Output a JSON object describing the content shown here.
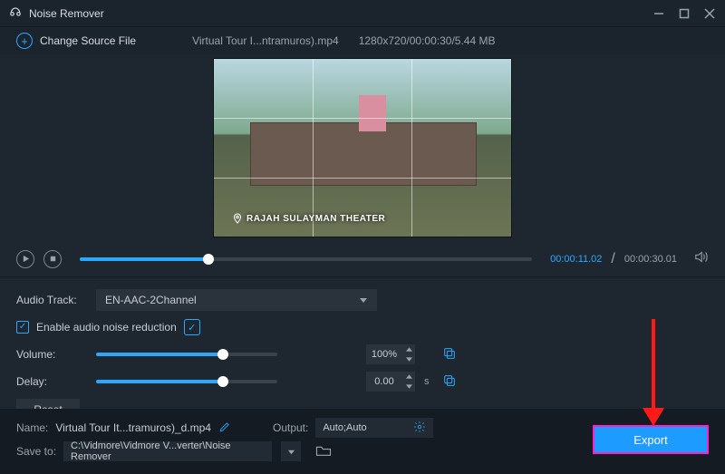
{
  "titlebar": {
    "app_name": "Noise Remover"
  },
  "toolbar": {
    "change_source_label": "Change Source File",
    "source_filename": "Virtual Tour I...ntramuros).mp4",
    "source_meta": "1280x720/00:00:30/5.44 MB"
  },
  "preview": {
    "caption": "RAJAH SULAYMAN THEATER"
  },
  "playback": {
    "current_time": "00:00:11.02",
    "duration": "00:00:30.01",
    "progress_pct": 28.5
  },
  "controls": {
    "audio_track_label": "Audio Track:",
    "audio_track_value": "EN-AAC-2Channel",
    "enable_noise_label": "Enable audio noise reduction",
    "enable_noise_checked": true,
    "volume_label": "Volume:",
    "volume_value": "100%",
    "volume_pct": 70,
    "delay_label": "Delay:",
    "delay_value": "0.00",
    "delay_unit": "s",
    "delay_pct": 70,
    "reset_label": "Reset"
  },
  "bottom": {
    "name_label": "Name:",
    "name_value": "Virtual Tour It...tramuros)_d.mp4",
    "output_label": "Output:",
    "output_value": "Auto;Auto",
    "save_to_label": "Save to:",
    "save_to_value": "C:\\Vidmore\\Vidmore V...verter\\Noise Remover",
    "export_label": "Export"
  },
  "colors": {
    "accent": "#2aa8ff",
    "export_bg": "#1e9bff",
    "highlight_border": "#ff1ec8",
    "arrow": "#ff1a1a"
  }
}
